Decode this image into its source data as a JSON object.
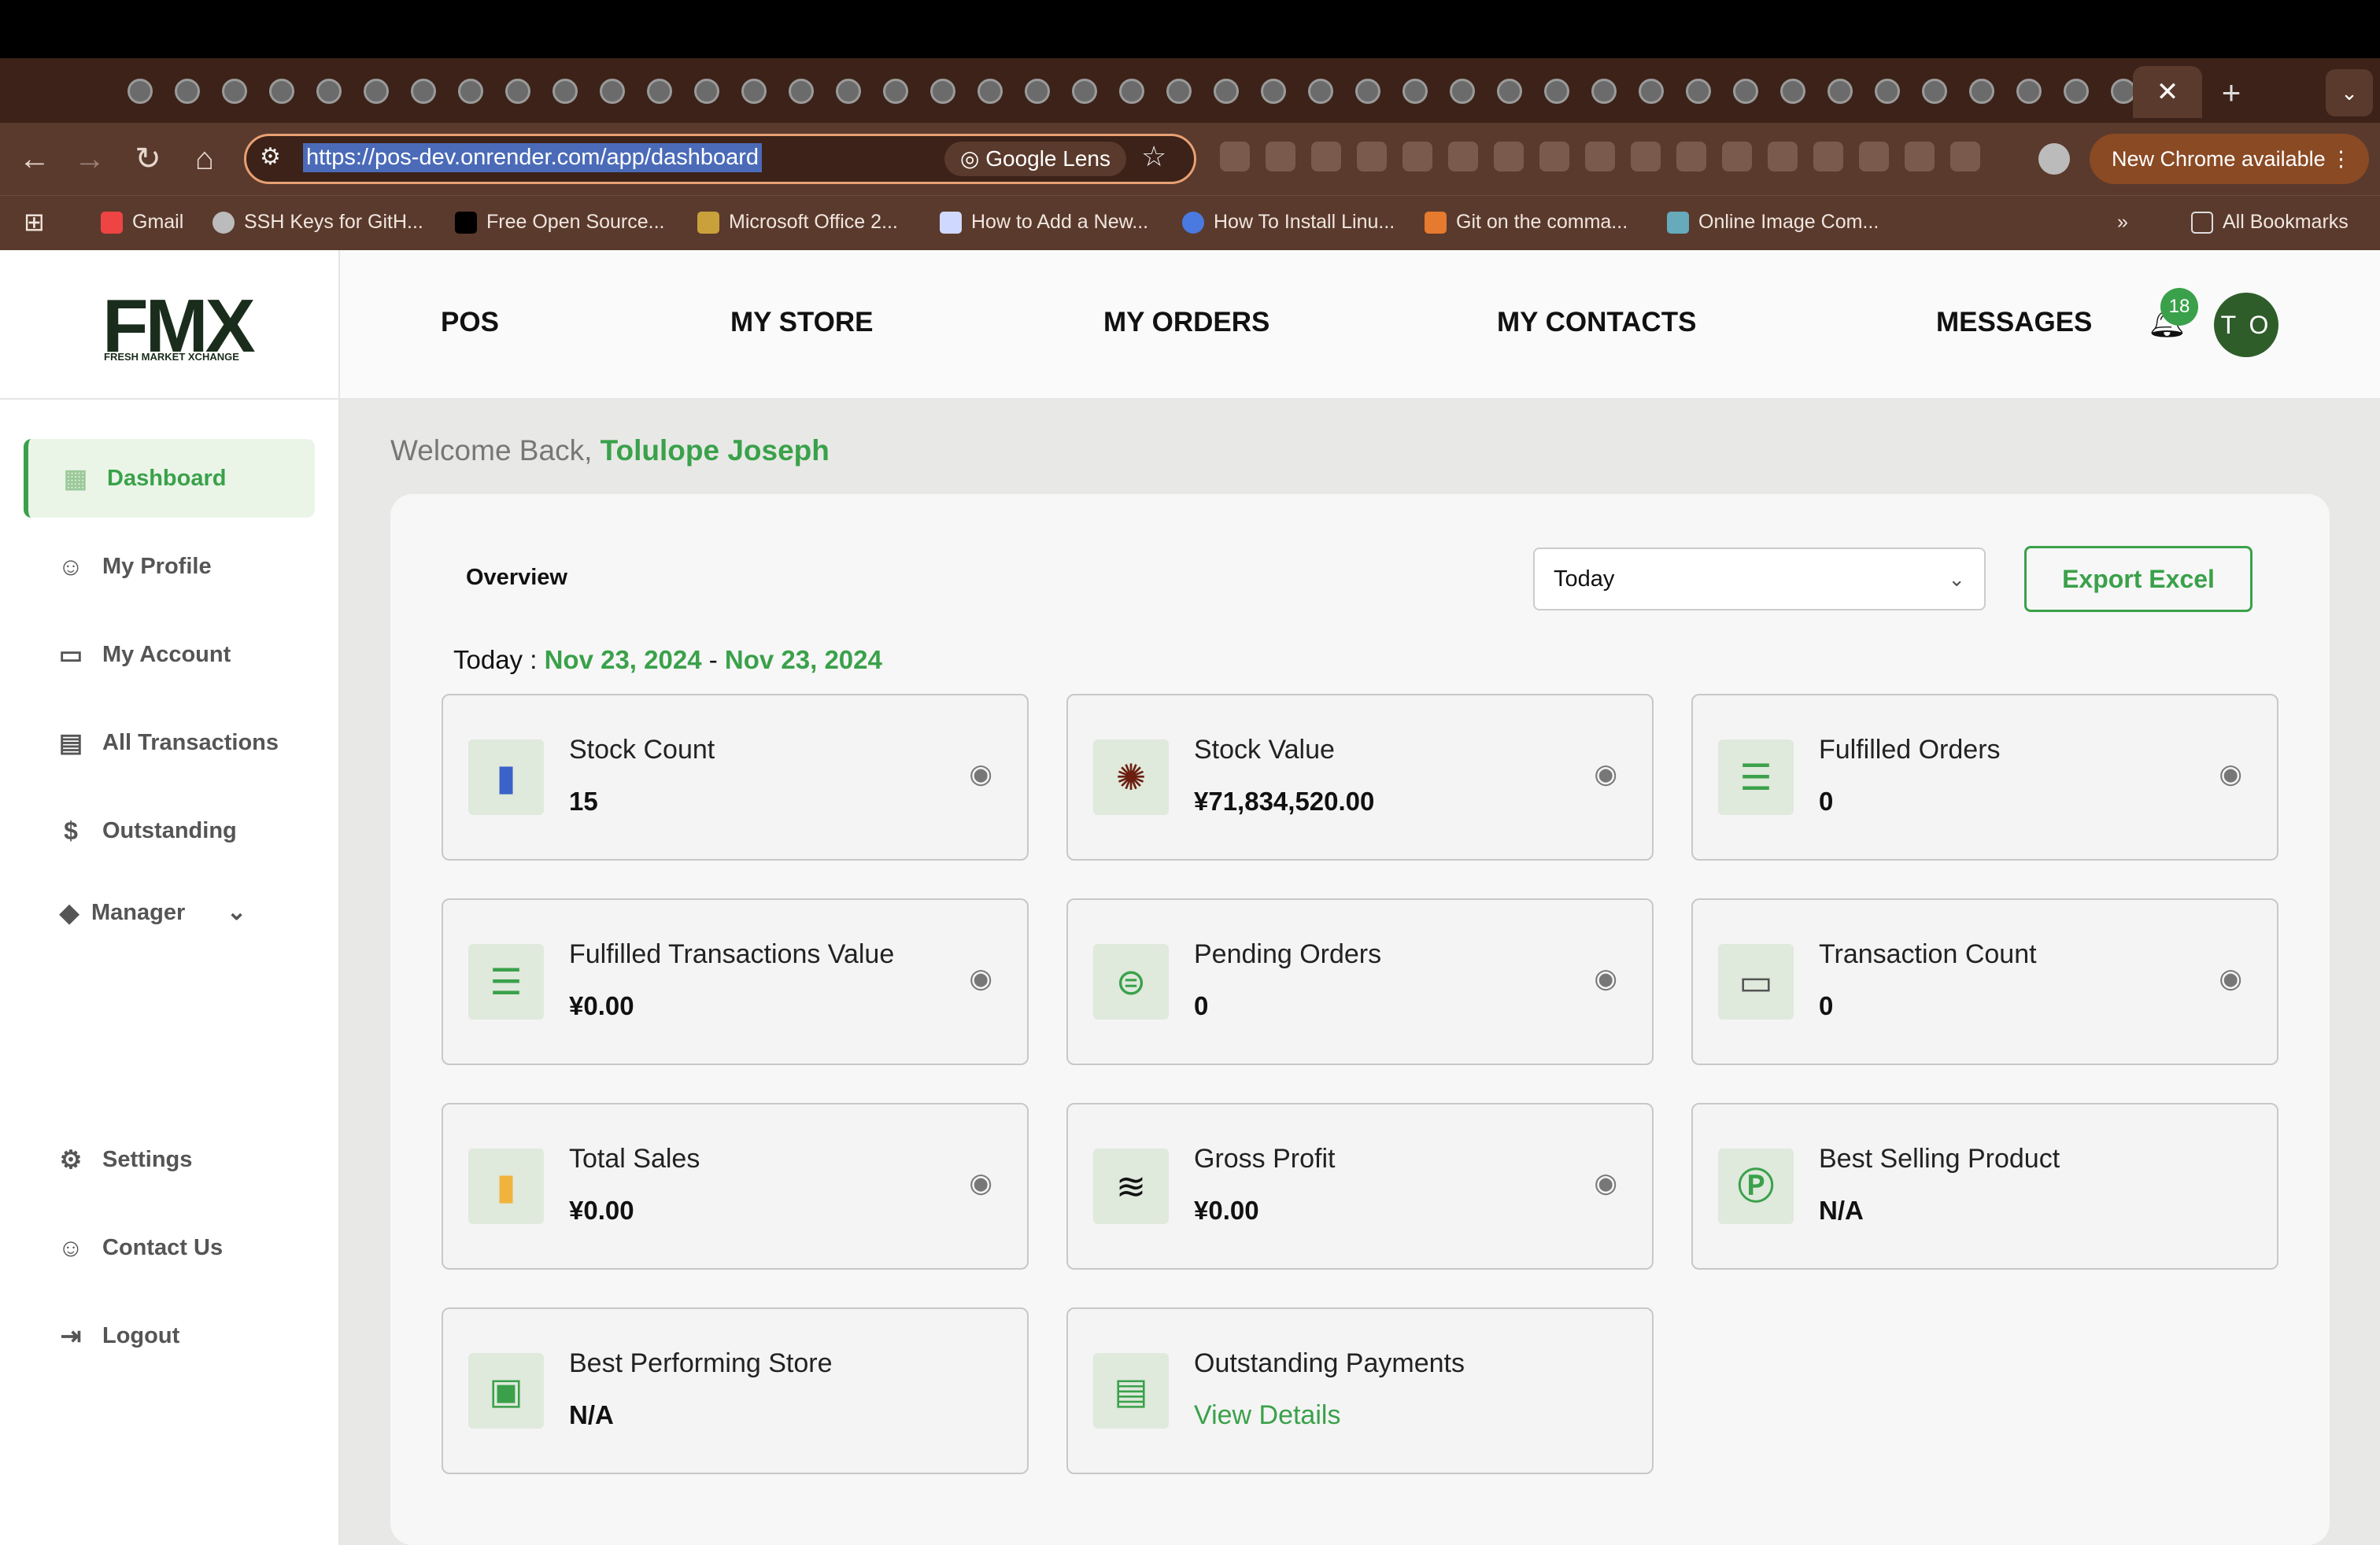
{
  "browser": {
    "url": "https://pos-dev.onrender.com/app/dashboard",
    "lens_label": "Google Lens",
    "update_label": "New Chrome available",
    "bookmarks": [
      "Gmail",
      "SSH Keys for GitH...",
      "Free Open Source...",
      "Microsoft Office 2...",
      "How to Add a New...",
      "How To Install Linu...",
      "Git on the comma...",
      "Online Image Com..."
    ],
    "all_bookmarks": "All Bookmarks"
  },
  "header": {
    "logo": "FMX",
    "logo_sub": "FRESH MARKET XCHANGE",
    "nav": [
      "POS",
      "MY STORE",
      "MY ORDERS",
      "MY CONTACTS",
      "MESSAGES"
    ],
    "notification_count": "18",
    "avatar_initials": "T O"
  },
  "sidebar": {
    "items": [
      {
        "label": "Dashboard",
        "icon": "grid-icon"
      },
      {
        "label": "My Profile",
        "icon": "user-icon"
      },
      {
        "label": "My Account",
        "icon": "wallet-icon"
      },
      {
        "label": "All Transactions",
        "icon": "calculator-icon"
      },
      {
        "label": "Outstanding",
        "icon": "dollar-icon"
      },
      {
        "label": "Manager",
        "icon": "diamond-icon"
      },
      {
        "label": "Settings",
        "icon": "gear-icon"
      },
      {
        "label": "Contact Us",
        "icon": "users-icon"
      },
      {
        "label": "Logout",
        "icon": "logout-icon"
      }
    ]
  },
  "main": {
    "welcome": "Welcome Back,",
    "user_name": "Tolulope Joseph",
    "overview": "Overview",
    "period_select": "Today",
    "export_label": "Export Excel",
    "range_label": "Today :",
    "range_start": "Nov 23, 2024",
    "range_sep": "-",
    "range_end": "Nov 23, 2024",
    "cards": [
      {
        "title": "Stock Count",
        "value": "15"
      },
      {
        "title": "Stock Value",
        "value": "¥71,834,520.00"
      },
      {
        "title": "Fulfilled Orders",
        "value": "0"
      },
      {
        "title": "Fulfilled Transactions Value",
        "value": "¥0.00"
      },
      {
        "title": "Pending Orders",
        "value": "0"
      },
      {
        "title": "Transaction Count",
        "value": "0"
      },
      {
        "title": "Total Sales",
        "value": "¥0.00"
      },
      {
        "title": "Gross Profit",
        "value": "¥0.00"
      },
      {
        "title": "Best Selling Product",
        "value": "N/A"
      },
      {
        "title": "Best Performing Store",
        "value": "N/A"
      },
      {
        "title": "Outstanding Payments",
        "value": "View Details"
      }
    ]
  },
  "colors": {
    "accent": "#3aa14a",
    "chrome": "#5a3a2c"
  }
}
